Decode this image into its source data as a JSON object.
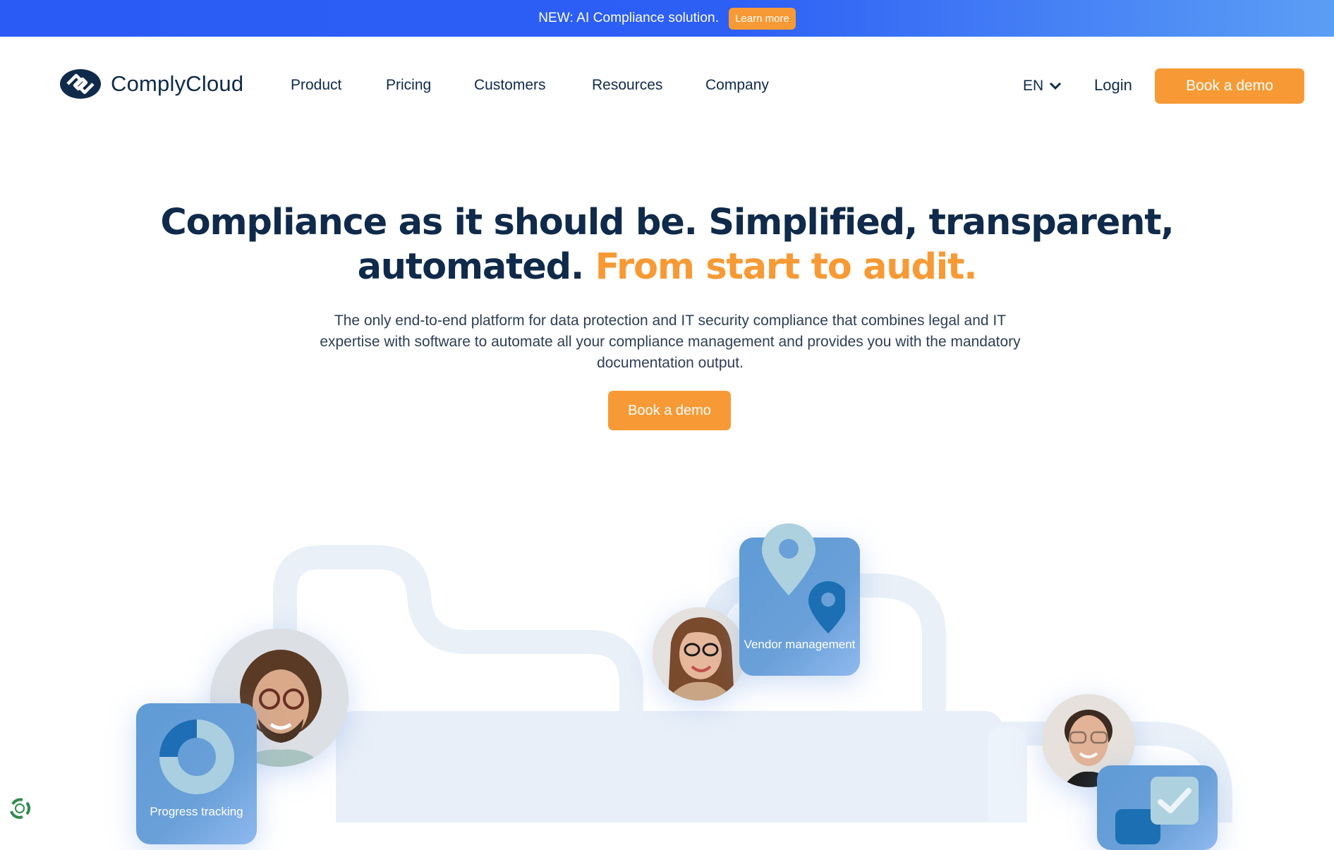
{
  "banner": {
    "text": "NEW: AI Compliance solution.",
    "button_label": "Learn more"
  },
  "nav": {
    "logo_text": "ComplyCloud",
    "items": [
      {
        "label": "Product"
      },
      {
        "label": "Pricing"
      },
      {
        "label": "Customers"
      },
      {
        "label": "Resources"
      },
      {
        "label": "Company"
      }
    ],
    "language": "EN",
    "login_label": "Login",
    "cta_label": "Book a demo"
  },
  "hero": {
    "title_part1": "Compliance as it should be. Simplified, transparent,",
    "title_part2": "automated.",
    "title_accent": "From start to audit.",
    "subtitle": "The only end-to-end platform for data protection and IT security compliance that combines legal and IT expertise with software to automate all your compliance management and provides you with the mandatory documentation output.",
    "cta_label": "Book a demo"
  },
  "illustration": {
    "cards": [
      {
        "label": "Vendor management",
        "icon": "map-pin-icon"
      },
      {
        "label": "Progress tracking",
        "icon": "donut-chart-icon",
        "progress_fraction": 0.25
      },
      {
        "label": "",
        "icon": "checkbox-icon"
      }
    ]
  },
  "colors": {
    "brand_navy": "#0f2a4a",
    "accent_orange": "#f79a35",
    "banner_blue": "#2a5cf5",
    "card_blue": "#6aa0d8",
    "path_pale": "#e8f0f8"
  }
}
